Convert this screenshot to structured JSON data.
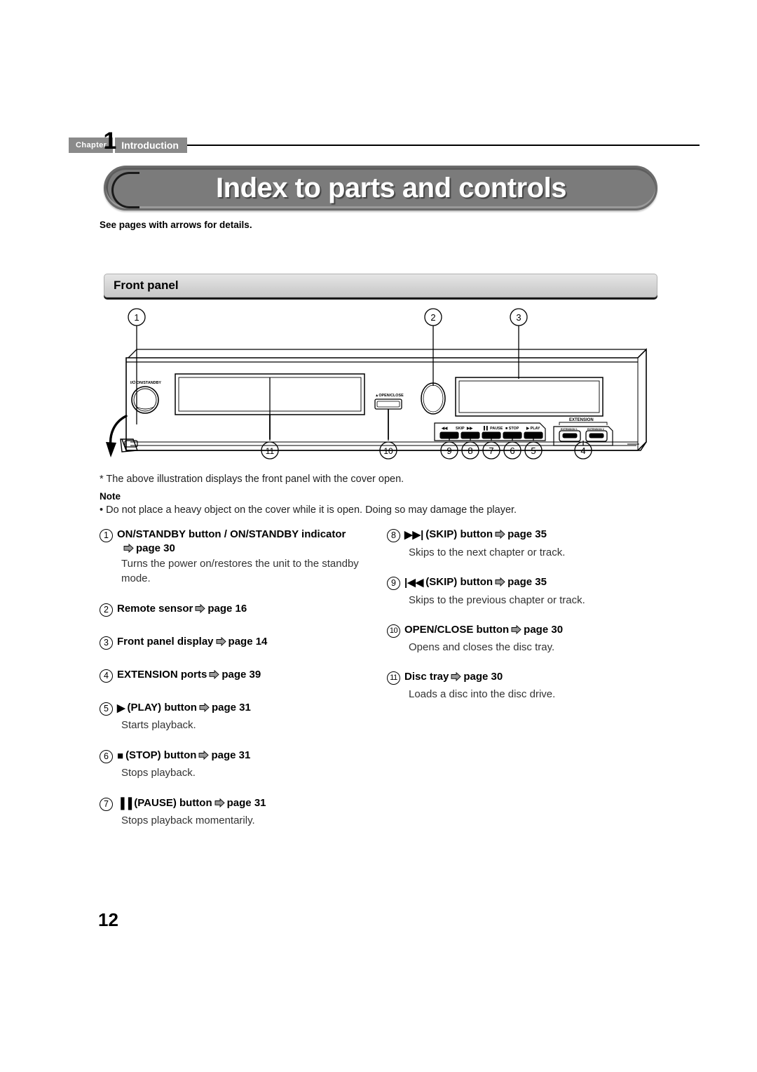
{
  "chapter": {
    "label": "Chapter",
    "number": "1",
    "name": "Introduction"
  },
  "title": "Index to parts and controls",
  "intro_line": "See pages with arrows for details.",
  "section": {
    "heading": "Front panel"
  },
  "diagram": {
    "callouts_top": [
      "1",
      "2",
      "3"
    ],
    "callouts_bottom": [
      "11",
      "10",
      "9",
      "8",
      "7",
      "6",
      "5",
      "4"
    ],
    "panel_labels": {
      "standby": "I/⏻ ON/STANDBY",
      "open_close": "▲OPEN/CLOSE",
      "skip_prev": "◀◀",
      "skip_label": "SKIP",
      "skip_next": "▶▶",
      "pause": "PAUSE",
      "stop": "STOP",
      "play": "PLAY",
      "extension": "EXTENSION",
      "extension_port_1": "EXTENSION 1",
      "extension_port_2": "EXTENSION 2"
    }
  },
  "footnote": "* The above illustration displays the front panel with the cover open.",
  "note": {
    "label": "Note",
    "text": "• Do not place a heavy object on the cover while it is open. Doing so may damage the player."
  },
  "legend": {
    "left": [
      {
        "num": "1",
        "glyph": "",
        "title": "ON/STANDBY button / ON/STANDBY indicator",
        "page_same_line": false,
        "page": "page 30",
        "desc": "Turns the power on/restores the unit to the standby mode."
      },
      {
        "num": "2",
        "glyph": "",
        "title": "Remote sensor",
        "page_same_line": true,
        "page": "page 16",
        "desc": ""
      },
      {
        "num": "3",
        "glyph": "",
        "title": "Front panel display",
        "page_same_line": true,
        "page": "page 14",
        "desc": ""
      },
      {
        "num": "4",
        "glyph": "",
        "title": "EXTENSION ports",
        "page_same_line": true,
        "page": "page 39",
        "desc": ""
      },
      {
        "num": "5",
        "glyph": "▶",
        "title": "(PLAY) button",
        "page_same_line": true,
        "page": "page 31",
        "desc": "Starts playback."
      },
      {
        "num": "6",
        "glyph": "■",
        "title": "(STOP) button",
        "page_same_line": true,
        "page": "page 31",
        "desc": "Stops playback."
      },
      {
        "num": "7",
        "glyph": "▐▐",
        "title": "(PAUSE) button",
        "page_same_line": true,
        "page": "page 31",
        "desc": "Stops playback momentarily."
      }
    ],
    "right": [
      {
        "num": "8",
        "glyph": "▶▶|",
        "title": "(SKIP) button",
        "page_same_line": true,
        "page": "page 35",
        "desc": "Skips to the next chapter or track."
      },
      {
        "num": "9",
        "glyph": "|◀◀",
        "title": "(SKIP) button",
        "page_same_line": true,
        "page": "page 35",
        "desc": "Skips to the previous chapter or track."
      },
      {
        "num": "10",
        "glyph": "",
        "title": "OPEN/CLOSE button",
        "page_same_line": true,
        "page": "page 30",
        "desc": "Opens and closes the disc tray."
      },
      {
        "num": "11",
        "glyph": "",
        "title": "Disc tray",
        "page_same_line": true,
        "page": "page 30",
        "desc": "Loads a disc into the disc drive."
      }
    ]
  },
  "page_number": "12",
  "colors": {
    "chapter_tab": "#8a8a8a",
    "title_pill": "#7b7b7b",
    "section_bar": "#d2d2d2",
    "arrow_fill": "#9a9a9a"
  }
}
